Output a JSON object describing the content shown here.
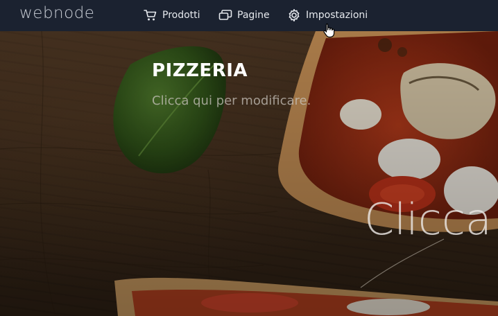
{
  "header": {
    "logo": "webnode",
    "nav": [
      {
        "label": "Prodotti",
        "icon": "cart-icon"
      },
      {
        "label": "Pagine",
        "icon": "pages-icon"
      },
      {
        "label": "Impostazioni",
        "icon": "gear-icon"
      }
    ]
  },
  "hero": {
    "title": "PIZZERIA",
    "subtitle": "Clicca qui per modificare.",
    "big_text": "Clicca"
  },
  "colors": {
    "topbar_bg": "#1b2230",
    "nav_text": "#e6e9ee",
    "logo": "#c7ccd4"
  }
}
